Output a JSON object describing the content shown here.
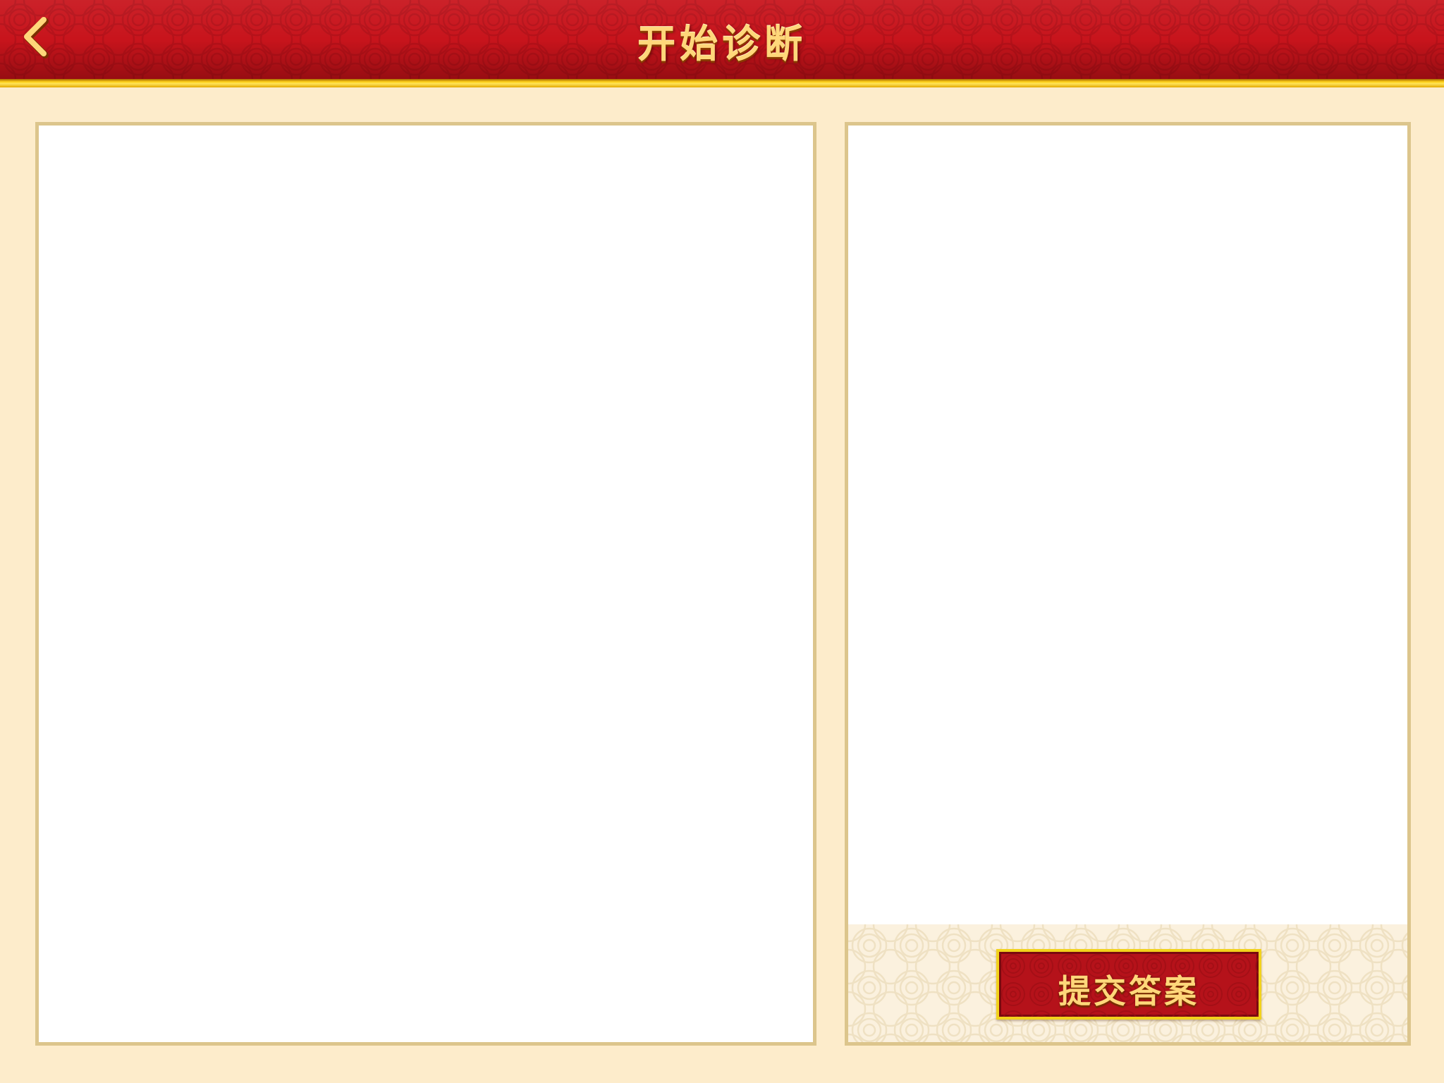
{
  "header": {
    "title": "开始诊断",
    "back_icon": "chevron-left-icon"
  },
  "diagnosis": {
    "submit_label": "提交答案"
  },
  "colors": {
    "header_red": "#c8141c",
    "gold": "#ffd21a",
    "background": "#fdeccb",
    "panel_border": "#dcc58c"
  }
}
